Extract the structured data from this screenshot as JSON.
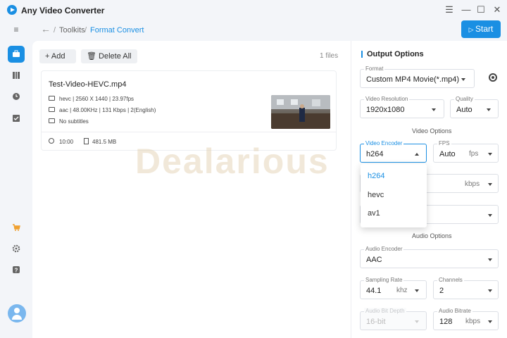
{
  "app": {
    "title": "Any Video Converter"
  },
  "window": {
    "menu": "☰",
    "minimize": "—",
    "maximize": "☐",
    "close": "✕"
  },
  "sidebar": {
    "menu_toggle": "≡",
    "items": [
      {
        "name": "toolkits",
        "icon": "briefcase-icon",
        "active": true
      },
      {
        "name": "library",
        "icon": "columns-icon",
        "active": false
      },
      {
        "name": "history",
        "icon": "clock-icon",
        "active": false
      },
      {
        "name": "tasks",
        "icon": "checklist-icon",
        "active": false
      },
      {
        "name": "store",
        "icon": "cart-icon",
        "active": false
      },
      {
        "name": "settings",
        "icon": "gear-icon",
        "active": false
      },
      {
        "name": "help",
        "icon": "help-icon",
        "active": false
      }
    ]
  },
  "breadcrumb": {
    "sep": "/",
    "root": "Toolkits",
    "current": "Format Convert"
  },
  "toolbar": {
    "start": "Start",
    "add": "Add",
    "delete_all": "Delete All",
    "files_count": "1 files"
  },
  "file": {
    "name": "Test-Video-HEVC.mp4",
    "video": "hevc | 2560 X 1440 | 23.97fps",
    "audio": "aac | 48.00KHz | 131 Kbps | 2(English)",
    "subtitles": "No subtitles",
    "duration": "10:00",
    "size": "481.5 MB"
  },
  "watermark": "Dealarious",
  "output": {
    "title": "Output Options",
    "format_label": "Format",
    "format_value": "Custom MP4 Movie(*.mp4)",
    "resolution_label": "Video Resolution",
    "resolution_value": "1920x1080",
    "quality_label": "Quality",
    "quality_value": "Auto",
    "video_options": "Video Options",
    "encoder_label": "Video Encoder",
    "encoder_value": "h264",
    "fps_label": "FPS",
    "fps_value": "Auto",
    "fps_unit": "fps",
    "bitrate_unit": "kbps",
    "audio_options": "Audio Options",
    "audio_encoder_label": "Audio Encoder",
    "audio_encoder_value": "AAC",
    "sampling_label": "Sampling Rate",
    "sampling_value": "44.1",
    "sampling_unit": "khz",
    "channels_label": "Channels",
    "channels_value": "2",
    "bitdepth_label": "Audio Bit Depth",
    "bitdepth_value": "16-bit",
    "audio_bitrate_label": "Audio Bitrate",
    "audio_bitrate_value": "128",
    "audio_bitrate_unit": "kbps"
  },
  "encoder_dropdown": {
    "options": [
      "h264",
      "hevc",
      "av1"
    ],
    "selected": "h264"
  },
  "colors": {
    "accent": "#1a8fe3",
    "background": "#f3f5f9"
  }
}
